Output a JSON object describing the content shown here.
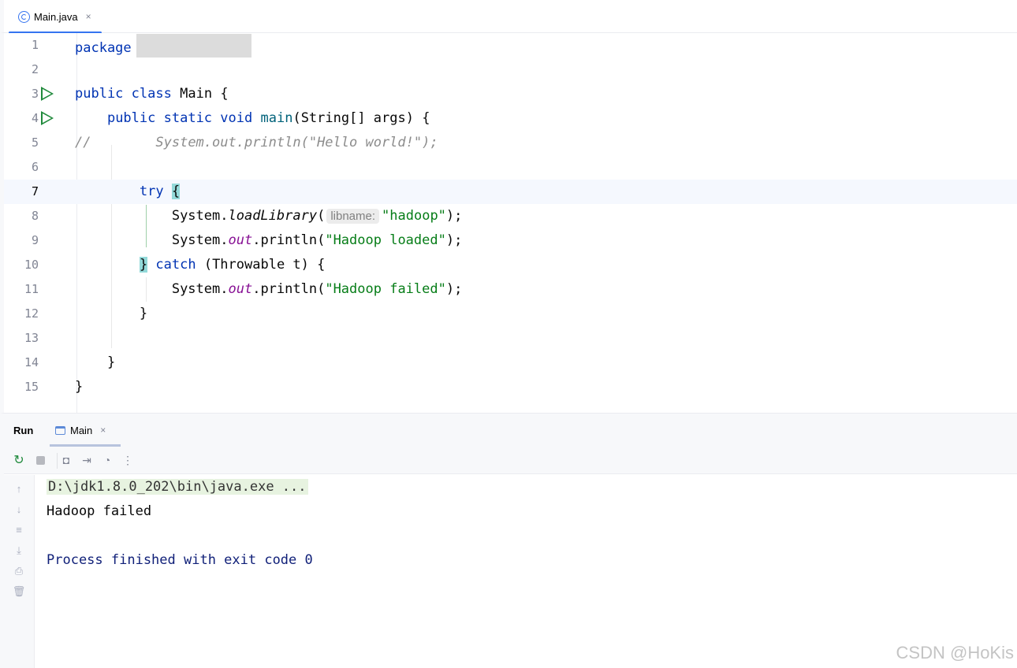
{
  "editor_tab": {
    "label": "Main.java",
    "close": "×"
  },
  "editor": {
    "line_numbers": [
      "1",
      "2",
      "3",
      "4",
      "5",
      "6",
      "7",
      "8",
      "9",
      "10",
      "11",
      "12",
      "13",
      "14",
      "15"
    ],
    "kw_package": "package",
    "kw_public": "public",
    "kw_class": "class",
    "class_name": "Main",
    "brace_open": "{",
    "kw_static": "static",
    "kw_void": "void",
    "method_main": "main",
    "main_params": "(String[] args) {",
    "comment_prefix": "//",
    "comment_code": "System.out.println(\"Hello world!\");",
    "kw_try": "try",
    "system": "System.",
    "load_library": "loadLibrary",
    "paren_open": "(",
    "hint_libname": "libname:",
    "str_hadoop": "\"hadoop\"",
    "paren_close_semi": ");",
    "out": "out",
    "println_open": ".println(",
    "str_loaded": "\"Hadoop loaded\"",
    "brace_close": "}",
    "kw_catch": "catch",
    "catch_params": "(Throwable t) {",
    "str_failed": "\"Hadoop failed\""
  },
  "run_panel": {
    "title": "Run",
    "tab_label": "Main",
    "tab_close": "×",
    "toolbar_icons": [
      "rerun-icon",
      "stop-icon",
      "camera-icon",
      "exit-icon",
      "profiler-icon",
      "more-icon"
    ],
    "sidebar_icons": [
      "up-arrow-icon",
      "down-arrow-icon",
      "soft-wrap-icon",
      "scroll-end-icon",
      "print-icon",
      "trash-icon"
    ]
  },
  "console": {
    "command": "D:\\jdk1.8.0_202\\bin\\java.exe ...",
    "output": "Hadoop failed",
    "exit_message": "Process finished with exit code 0"
  },
  "watermark": "CSDN @HoKis",
  "colors": {
    "keyword": "#0033b3",
    "string": "#067d17",
    "static_field": "#871094",
    "comment": "#8c8c8c",
    "accent": "#3574f0",
    "run_green": "#208a3c"
  }
}
